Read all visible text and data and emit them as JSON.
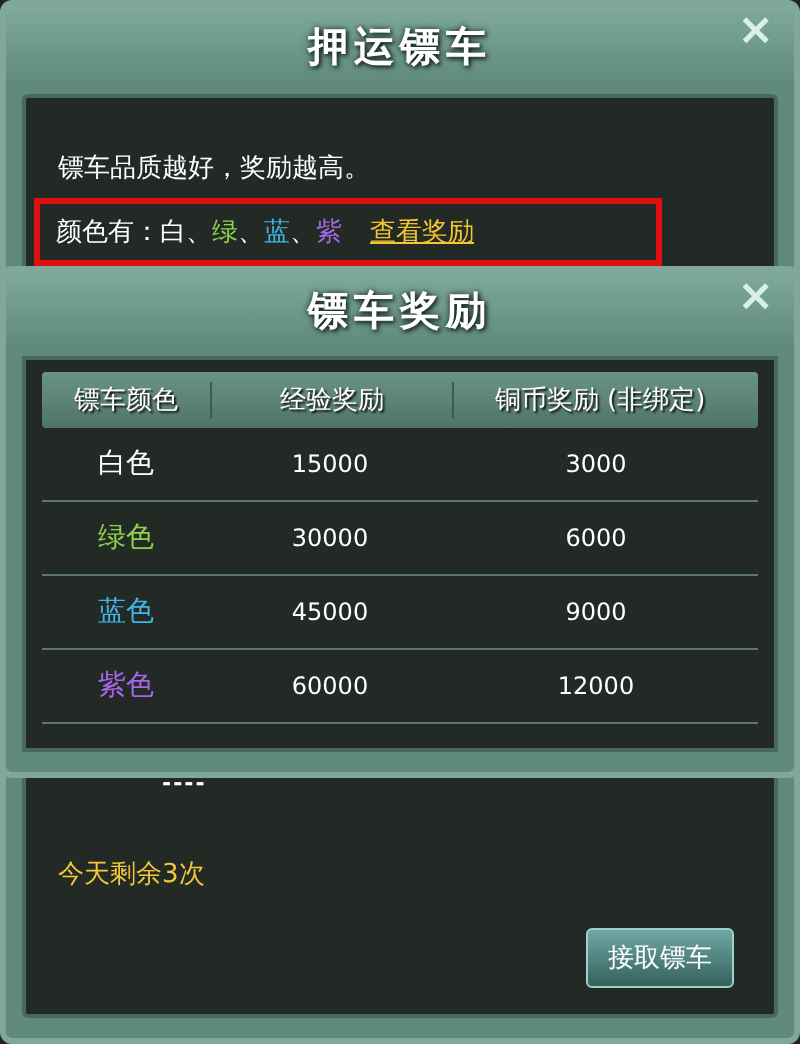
{
  "main_window": {
    "title": "押运镖车",
    "close": "×",
    "description": "镖车品质越好，奖励越高。",
    "colors_label": "颜色有：",
    "colors": [
      {
        "name": "白",
        "color": "#ffffff"
      },
      {
        "name": "绿",
        "color": "#8fd14f"
      },
      {
        "name": "蓝",
        "color": "#3fb6e6"
      },
      {
        "name": "紫",
        "color": "#a766e8"
      }
    ],
    "separator": "、",
    "view_rewards_link": "查看奖励",
    "dashes": "----",
    "remaining": "今天剩余3次",
    "accept_button": "接取镖车"
  },
  "reward_dialog": {
    "title": "镖车奖励",
    "close": "×",
    "table": {
      "columns": [
        "镖车颜色",
        "经验奖励",
        "铜币奖励 (非绑定)"
      ],
      "rows": [
        {
          "cells": [
            "白色",
            "15000",
            "3000"
          ],
          "color": "#ffffff"
        },
        {
          "cells": [
            "绿色",
            "30000",
            "6000"
          ],
          "color": "#8fd14f"
        },
        {
          "cells": [
            "蓝色",
            "45000",
            "9000"
          ],
          "color": "#3fb6e6"
        },
        {
          "cells": [
            "紫色",
            "60000",
            "12000"
          ],
          "color": "#a766e8"
        }
      ]
    }
  }
}
